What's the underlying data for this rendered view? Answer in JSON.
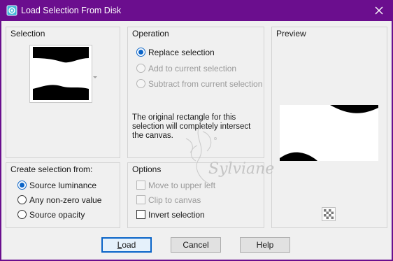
{
  "window": {
    "title": "Load Selection From Disk",
    "close_icon": "close-icon",
    "app_icon": "selection-icon"
  },
  "selection_group": {
    "title": "Selection"
  },
  "operation_group": {
    "title": "Operation",
    "options": [
      {
        "label": "Replace selection",
        "selected": true,
        "enabled": true
      },
      {
        "label": "Add to current selection",
        "selected": false,
        "enabled": false
      },
      {
        "label": "Subtract from current selection",
        "selected": false,
        "enabled": false
      }
    ],
    "info": "The original rectangle for this selection will completely intersect the canvas."
  },
  "preview_group": {
    "title": "Preview"
  },
  "create_from_group": {
    "title": "Create selection from:",
    "options": [
      {
        "label": "Source luminance",
        "selected": true
      },
      {
        "label": "Any non-zero value",
        "selected": false
      },
      {
        "label": "Source opacity",
        "selected": false
      }
    ]
  },
  "options_group": {
    "title": "Options",
    "checks": [
      {
        "label": "Move to upper left",
        "checked": false,
        "enabled": false
      },
      {
        "label": "Clip to canvas",
        "checked": false,
        "enabled": false
      },
      {
        "label": "Invert selection",
        "checked": false,
        "enabled": true
      }
    ]
  },
  "buttons": {
    "load": "Load",
    "cancel": "Cancel",
    "help": "Help"
  },
  "watermark": {
    "text": "Sylviane"
  },
  "colors": {
    "title_bar": "#6b0e8e",
    "accent": "#0a64c8"
  }
}
